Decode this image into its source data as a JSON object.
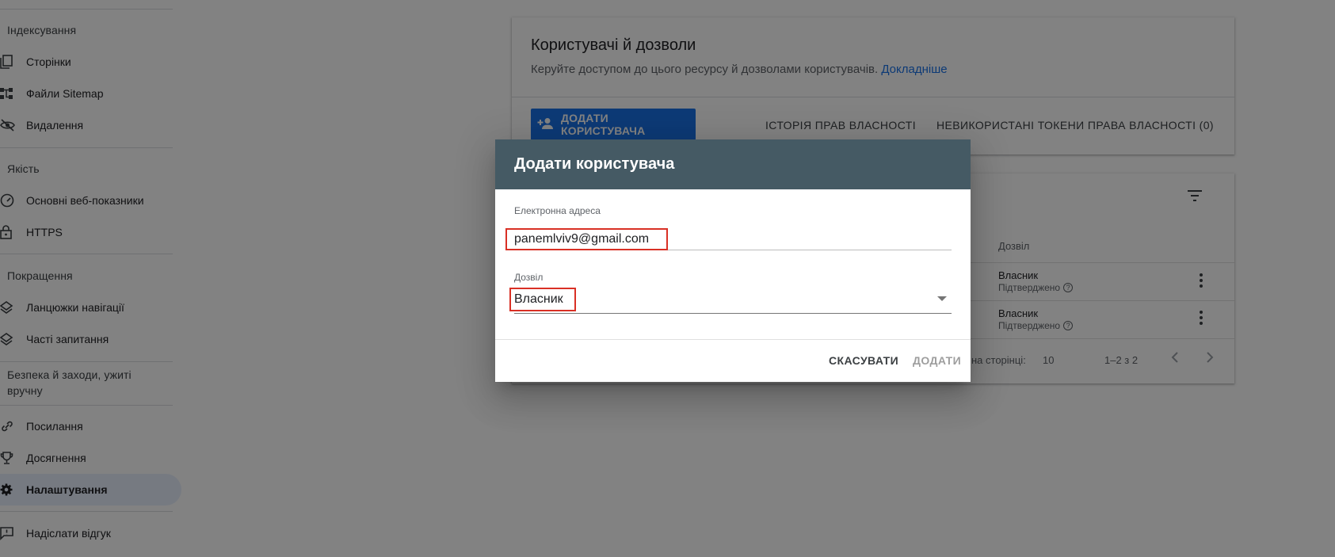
{
  "sidebar": {
    "sections": {
      "indexing": "Індексування",
      "quality": "Якість",
      "enhancements": "Покращення",
      "security": "Безпека й заходи, ужиті вручну"
    },
    "items": [
      {
        "label": "Сторінки",
        "icon": "pages-icon"
      },
      {
        "label": "Файли Sitemap",
        "icon": "sitemap-icon"
      },
      {
        "label": "Видалення",
        "icon": "removals-icon"
      },
      {
        "label": "Основні веб-показники",
        "icon": "speed-icon"
      },
      {
        "label": "HTTPS",
        "icon": "lock-icon"
      },
      {
        "label": "Ланцюжки навігації",
        "icon": "layers-icon"
      },
      {
        "label": "Часті запитання",
        "icon": "layers-icon"
      },
      {
        "label": "Посилання",
        "icon": "link-icon"
      },
      {
        "label": "Досягнення",
        "icon": "trophy-icon"
      },
      {
        "label": "Налаштування",
        "icon": "gear-icon",
        "active": true
      },
      {
        "label": "Надіслати відгук",
        "icon": "feedback-icon"
      }
    ]
  },
  "main": {
    "title": "Користувачі й дозволи",
    "description": "Керуйте доступом до цього ресурсу й дозволами користувачів.",
    "learn_more": "Докладніше",
    "add_user_button": "ДОДАТИ КОРИСТУВАЧА",
    "history_tab": "ІСТОРІЯ ПРАВ ВЛАСНОСТІ",
    "tokens_tab": "НЕВИКОРИСТАНІ ТОКЕНИ ПРАВА ВЛАСНОСТІ (0)",
    "table": {
      "column_permission": "Дозвіл",
      "rows": [
        {
          "role": "Власник",
          "state": "Підтверджено"
        },
        {
          "role": "Власник",
          "state": "Підтверджено"
        }
      ]
    },
    "pager": {
      "rows_label": "на сторінці:",
      "rows_value": "10",
      "range": "1–2 з 2"
    }
  },
  "dialog": {
    "title": "Додати користувача",
    "email_label": "Електронна адреса",
    "email_value": "panemlviv9@gmail.com",
    "permission_label": "Дозвіл",
    "permission_value": "Власник",
    "cancel": "СКАСУВАТИ",
    "add": "ДОДАТИ"
  },
  "colors": {
    "accent": "#1a73e8",
    "dialog_header": "#455a64",
    "highlight": "#d93025"
  }
}
